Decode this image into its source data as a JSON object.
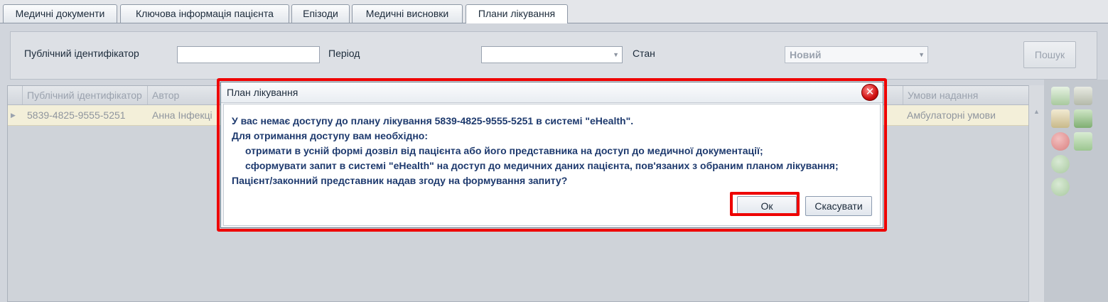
{
  "tabs": [
    {
      "label": "Медичні документи"
    },
    {
      "label": "Ключова інформація пацієнта"
    },
    {
      "label": "Епізоди"
    },
    {
      "label": "Медичні висновки"
    },
    {
      "label": "Плани лікування"
    }
  ],
  "filters": {
    "public_id_label": "Публічний ідентифікатор",
    "public_id_value": "",
    "period_label": "Період",
    "period_value": "",
    "status_label": "Стан",
    "status_value": "Новий",
    "search_label": "Пошук"
  },
  "grid": {
    "columns": [
      "Публічний ідентифікатор",
      "Автор",
      "Умови надання"
    ],
    "rows": [
      {
        "public_id": "5839-4825-9555-5251",
        "author": "Анна Інфекці",
        "conditions": "Амбулаторні умови"
      }
    ]
  },
  "dialog": {
    "title": "План лікування",
    "lines": [
      "У вас немає доступу до плану лікування 5839-4825-9555-5251 в системі \"eHealth\".",
      "Для отримання доступу вам необхідно:",
      "отримати в усній формі дозвіл від пацієнта або його представника на доступ до медичної документації;",
      "сформувати запит в системі \"eHealth\" на доступ до медичних даних пацієнта, пов'язаних з обраним планом лікування;",
      "Пацієнт/законний представник надав згоду на формування запиту?"
    ],
    "ok_label": "Ок",
    "cancel_label": "Скасувати"
  },
  "colors": {
    "highlight": "#ee0000",
    "message_text": "#1e3a6e",
    "selected_row": "#f3efd9"
  },
  "icons": [
    "close-icon",
    "document-icon",
    "tools-icon",
    "edit-icon",
    "refresh-icon",
    "cancel-icon",
    "flag-icon",
    "add-icon",
    "remove-icon"
  ]
}
